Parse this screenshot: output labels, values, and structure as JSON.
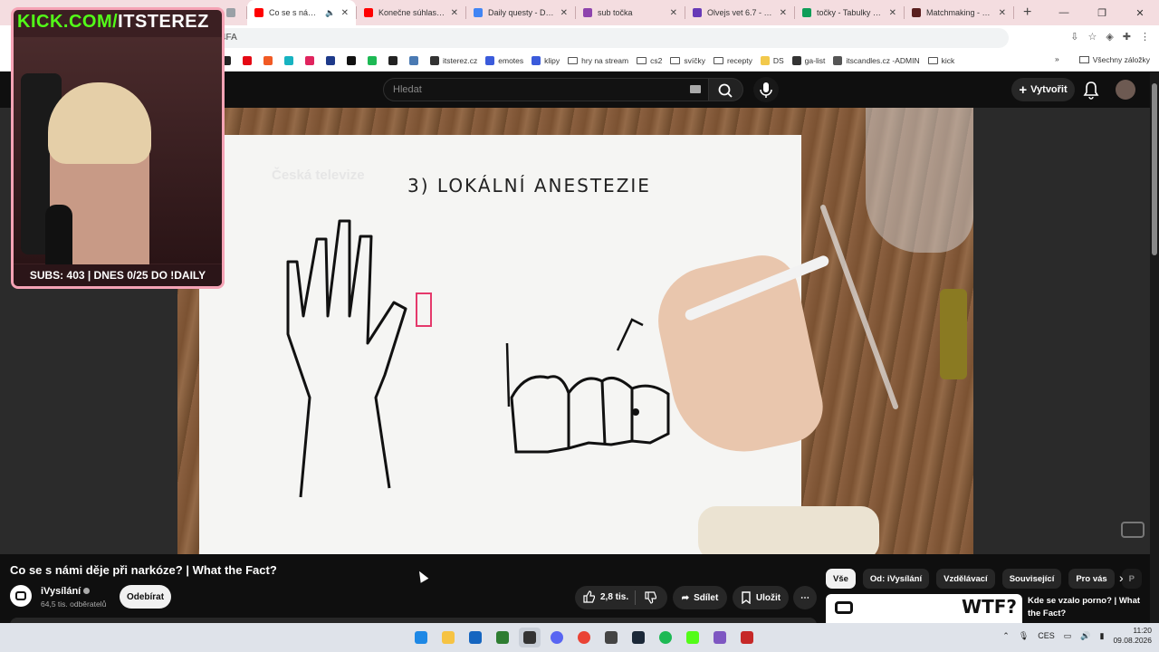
{
  "browser": {
    "tabs": [
      {
        "label": "",
        "color": "#9aa0a6",
        "active": false
      },
      {
        "label": "Co se s námi děje",
        "color": "#ff0000",
        "active": true,
        "sound": "🔈"
      },
      {
        "label": "Konečne súhlasil s pr",
        "color": "#ff0000",
        "active": false
      },
      {
        "label": "Daily questy - Dokum",
        "color": "#4285f4",
        "active": false
      },
      {
        "label": "sub točka",
        "color": "#8e44ad",
        "active": false
      },
      {
        "label": "Olvejs vet 6.7 - Form",
        "color": "#673ab7",
        "active": false
      },
      {
        "label": "točky - Tabulky Goog",
        "color": "#0f9d58",
        "active": false
      },
      {
        "label": "Matchmaking - Europ",
        "color": "#5a1f1f",
        "active": false
      }
    ],
    "new_tab": "+",
    "window_controls": {
      "minimize": "—",
      "maximize": "❐",
      "close": "✕"
    },
    "url": "4FA",
    "bookmarks": [
      {
        "label": "",
        "color": "#222222",
        "type": "icon"
      },
      {
        "label": "",
        "color": "#e50914",
        "type": "icon"
      },
      {
        "label": "",
        "color": "#f15a24",
        "type": "icon"
      },
      {
        "label": "",
        "color": "#17b3c1",
        "type": "icon"
      },
      {
        "label": "",
        "color": "#e0245e",
        "type": "icon"
      },
      {
        "label": "",
        "color": "#1e3a8a",
        "type": "icon"
      },
      {
        "label": "",
        "color": "#111111",
        "type": "icon"
      },
      {
        "label": "",
        "color": "#1db954",
        "type": "icon"
      },
      {
        "label": "",
        "color": "#222222",
        "type": "icon"
      },
      {
        "label": "",
        "color": "#4a7ab3",
        "type": "icon"
      },
      {
        "label": "itsterez.cz",
        "color": "#333333",
        "type": "icon"
      },
      {
        "label": "emotes",
        "color": "#3b5bdb",
        "type": "icon"
      },
      {
        "label": "klipy",
        "color": "#3b5bdb",
        "type": "icon"
      },
      {
        "label": "hry na stream",
        "type": "folder"
      },
      {
        "label": "cs2",
        "type": "folder"
      },
      {
        "label": "svíčky",
        "type": "folder"
      },
      {
        "label": "recepty",
        "type": "folder"
      },
      {
        "label": "DS",
        "color": "#f2c94c",
        "type": "icon"
      },
      {
        "label": "ga-list",
        "color": "#333333",
        "type": "icon"
      },
      {
        "label": "itscandles.cz -ADMIN",
        "color": "#555555",
        "type": "icon"
      },
      {
        "label": "kick",
        "type": "folder"
      }
    ],
    "bookmarks_overflow": "»",
    "all_bookmarks": "Všechny záložky"
  },
  "youtube": {
    "search_placeholder": "Hledat",
    "create_label": "Vytvořit",
    "video": {
      "title": "Co se s námi děje při narkóze? | What the Fact?",
      "drawing_heading": "3) LOKÁLNÍ ANESTEZIE",
      "broadcaster_watermark": "Česká televize"
    },
    "channel": {
      "name": "iVysílání",
      "subscribers": "64,5 tis. odběratelů",
      "subscribe_label": "Odebírat"
    },
    "actions": {
      "likes": "2,8 tis.",
      "share": "Sdílet",
      "save": "Uložit",
      "more": "⋯"
    },
    "chips": [
      "Vše",
      "Od: iVysílání",
      "Vzdělávací",
      "Související",
      "Pro vás",
      "P"
    ],
    "recommendation": {
      "title": "Kde se vzalo porno? | What the Fact?",
      "thumb_text": "WTF?"
    }
  },
  "stream_overlay": {
    "site": "KICK.COM/",
    "handle": "ITSTEREZ",
    "subs_line": "SUBS: 403 | DNES 0/25 DO !DAILY"
  },
  "taskbar": {
    "apps": [
      {
        "name": "windows",
        "color": "#1e88e5"
      },
      {
        "name": "explorer",
        "color": "#f6c343"
      },
      {
        "name": "ccleaner",
        "color": "#1565c0"
      },
      {
        "name": "terminal",
        "color": "#2e7d32"
      },
      {
        "name": "obs",
        "color": "#333333"
      },
      {
        "name": "discord",
        "color": "#5865f2"
      },
      {
        "name": "chrome",
        "color": "#ea4335"
      },
      {
        "name": "app",
        "color": "#444444"
      },
      {
        "name": "steam",
        "color": "#1b2838"
      },
      {
        "name": "spotify",
        "color": "#1db954"
      },
      {
        "name": "kick",
        "color": "#53fc18"
      },
      {
        "name": "app2",
        "color": "#7e57c2"
      },
      {
        "name": "shield",
        "color": "#c62828"
      }
    ],
    "language": "CES",
    "time": "11:20",
    "date": "09.08.2026"
  }
}
